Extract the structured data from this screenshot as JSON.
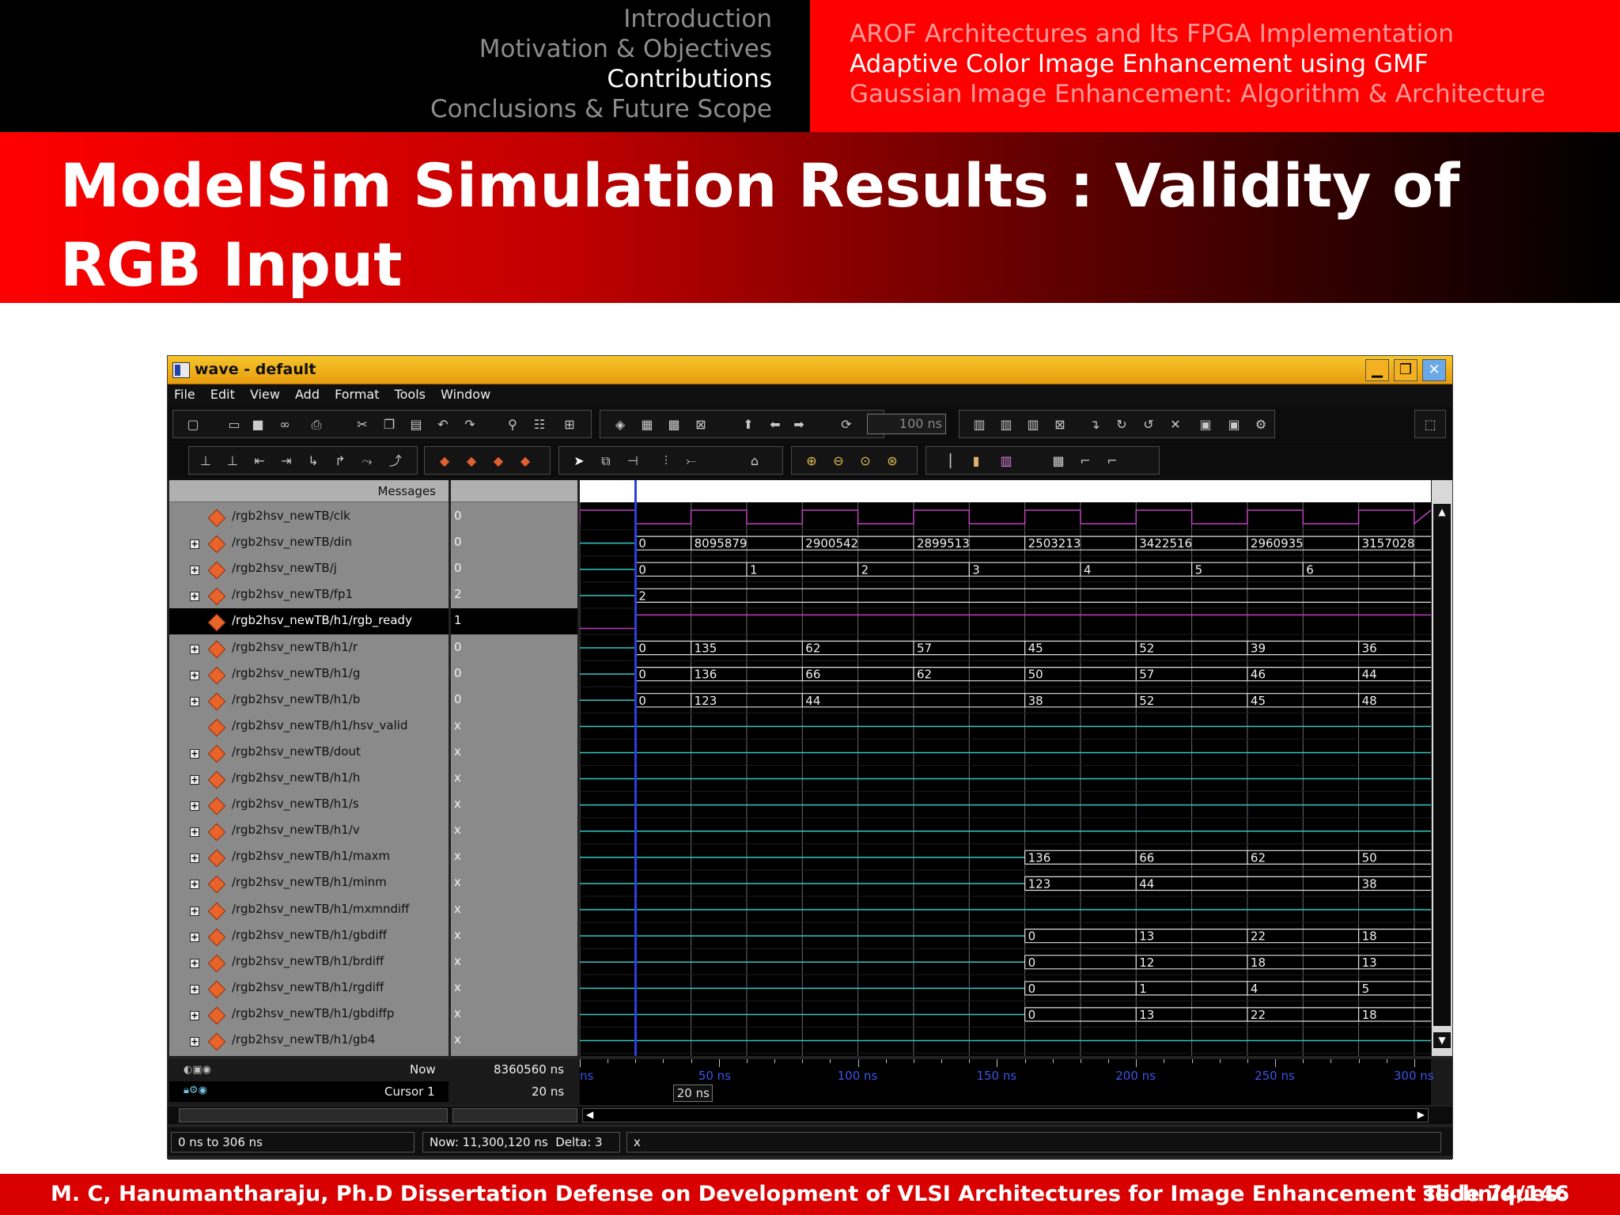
{
  "header": {
    "sections": [
      {
        "label": "Introduction",
        "active": false
      },
      {
        "label": "Motivation & Objectives",
        "active": false
      },
      {
        "label": "Contributions",
        "active": true
      },
      {
        "label": "Conclusions & Future Scope",
        "active": false
      }
    ],
    "subsections": [
      {
        "label": "AROF Architectures and Its FPGA Implementation",
        "active": false
      },
      {
        "label": "Adaptive Color Image Enhancement using GMF",
        "active": true
      },
      {
        "label": "Gaussian Image Enhancement: Algorithm & Architecture",
        "active": false
      }
    ]
  },
  "slide_title": "ModelSim Simulation Results : Validity of RGB Input",
  "window": {
    "title": "wave - default",
    "menu": [
      "File",
      "Edit",
      "View",
      "Add",
      "Format",
      "Tools",
      "Window"
    ],
    "time_input": "100 ns",
    "messages_header": "Messages",
    "signals": [
      {
        "name": "/rgb2hsv_newTB/clk",
        "value": "0",
        "expandable": false,
        "selected": false
      },
      {
        "name": "/rgb2hsv_newTB/din",
        "value": "0",
        "expandable": true,
        "selected": false
      },
      {
        "name": "/rgb2hsv_newTB/j",
        "value": "0",
        "expandable": true,
        "selected": false
      },
      {
        "name": "/rgb2hsv_newTB/fp1",
        "value": "2",
        "expandable": true,
        "selected": false
      },
      {
        "name": "/rgb2hsv_newTB/h1/rgb_ready",
        "value": "1",
        "expandable": false,
        "selected": true
      },
      {
        "name": "/rgb2hsv_newTB/h1/r",
        "value": "0",
        "expandable": true,
        "selected": false
      },
      {
        "name": "/rgb2hsv_newTB/h1/g",
        "value": "0",
        "expandable": true,
        "selected": false
      },
      {
        "name": "/rgb2hsv_newTB/h1/b",
        "value": "0",
        "expandable": true,
        "selected": false
      },
      {
        "name": "/rgb2hsv_newTB/h1/hsv_valid",
        "value": "x",
        "expandable": false,
        "selected": false
      },
      {
        "name": "/rgb2hsv_newTB/dout",
        "value": "x",
        "expandable": true,
        "selected": false
      },
      {
        "name": "/rgb2hsv_newTB/h1/h",
        "value": "x",
        "expandable": true,
        "selected": false
      },
      {
        "name": "/rgb2hsv_newTB/h1/s",
        "value": "x",
        "expandable": true,
        "selected": false
      },
      {
        "name": "/rgb2hsv_newTB/h1/v",
        "value": "x",
        "expandable": true,
        "selected": false
      },
      {
        "name": "/rgb2hsv_newTB/h1/maxm",
        "value": "x",
        "expandable": true,
        "selected": false
      },
      {
        "name": "/rgb2hsv_newTB/h1/minm",
        "value": "x",
        "expandable": true,
        "selected": false
      },
      {
        "name": "/rgb2hsv_newTB/h1/mxmndiff",
        "value": "x",
        "expandable": true,
        "selected": false
      },
      {
        "name": "/rgb2hsv_newTB/h1/gbdiff",
        "value": "x",
        "expandable": true,
        "selected": false
      },
      {
        "name": "/rgb2hsv_newTB/h1/brdiff",
        "value": "x",
        "expandable": true,
        "selected": false
      },
      {
        "name": "/rgb2hsv_newTB/h1/rgdiff",
        "value": "x",
        "expandable": true,
        "selected": false
      },
      {
        "name": "/rgb2hsv_newTB/h1/gbdiffp",
        "value": "x",
        "expandable": true,
        "selected": false
      },
      {
        "name": "/rgb2hsv_newTB/h1/gb4",
        "value": "x",
        "expandable": true,
        "selected": false
      }
    ],
    "bus_values": [
      {
        "row": 1,
        "time_ns": [
          20,
          40,
          80,
          120,
          160,
          200,
          240,
          280
        ],
        "labels": [
          "0",
          "8095879",
          "2900542",
          "2899513",
          "2503213",
          "3422516",
          "2960935",
          "3157028"
        ]
      },
      {
        "row": 2,
        "time_ns": [
          20,
          60,
          100,
          140,
          180,
          220,
          260,
          300
        ],
        "labels": [
          "0",
          "1",
          "2",
          "3",
          "4",
          "5",
          "6",
          ""
        ]
      },
      {
        "row": 3,
        "time_ns": [
          20
        ],
        "labels": [
          "2"
        ]
      },
      {
        "row": 5,
        "time_ns": [
          20,
          40,
          80,
          120,
          160,
          200,
          240,
          280
        ],
        "labels": [
          "0",
          "135",
          "62",
          "57",
          "45",
          "52",
          "39",
          "36"
        ]
      },
      {
        "row": 6,
        "time_ns": [
          20,
          40,
          80,
          120,
          160,
          200,
          240,
          280
        ],
        "labels": [
          "0",
          "136",
          "66",
          "62",
          "50",
          "57",
          "46",
          "44"
        ]
      },
      {
        "row": 7,
        "time_ns": [
          20,
          40,
          80,
          160,
          200,
          240,
          280
        ],
        "labels": [
          "0",
          "123",
          "44",
          "38",
          "52",
          "45",
          "48"
        ]
      },
      {
        "row": 13,
        "time_ns": [
          160,
          200,
          240,
          280
        ],
        "labels": [
          "136",
          "66",
          "62",
          "50"
        ]
      },
      {
        "row": 14,
        "time_ns": [
          160,
          200,
          280
        ],
        "labels": [
          "123",
          "44",
          "38"
        ]
      },
      {
        "row": 16,
        "time_ns": [
          160,
          200,
          240,
          280
        ],
        "labels": [
          "0",
          "13",
          "22",
          "18"
        ]
      },
      {
        "row": 17,
        "time_ns": [
          160,
          200,
          240,
          280
        ],
        "labels": [
          "0",
          "12",
          "18",
          "13"
        ]
      },
      {
        "row": 18,
        "time_ns": [
          160,
          200,
          240,
          280
        ],
        "labels": [
          "0",
          "1",
          "4",
          "5"
        ]
      },
      {
        "row": 19,
        "time_ns": [
          160,
          200,
          240,
          280
        ],
        "labels": [
          "0",
          "13",
          "22",
          "18"
        ]
      }
    ],
    "clock_period_ns": 40,
    "view_range_ns": [
      0,
      306
    ],
    "cursor_ns": 20,
    "now_label": "Now",
    "now_value": "8360560 ns",
    "cursor_label": "Cursor 1",
    "cursor_value": "20 ns",
    "cursor_box": "20 ns",
    "ruler_start": "ns",
    "ruler_ticks": [
      "50 ns",
      "100 ns",
      "150 ns",
      "200 ns",
      "250 ns",
      "300 ns"
    ],
    "status": {
      "range": "0 ns to 306 ns",
      "now": "Now: 11,300,120 ns",
      "delta": "Delta: 3",
      "extra": "x"
    },
    "colors": {
      "titlebar": "#f0b01e",
      "clock": "#c040c0",
      "bus": "#e0e0e0",
      "undefined": "#30c8c8",
      "cursor": "#2c3fd8",
      "ruler_text": "#3b56e8"
    }
  },
  "footer": {
    "text": "M. C, Hanumantharaju, Ph.D Dissertation Defense on Development of VLSI Architectures for Image Enhancement Techniques:",
    "slide": "slide 74/146"
  }
}
